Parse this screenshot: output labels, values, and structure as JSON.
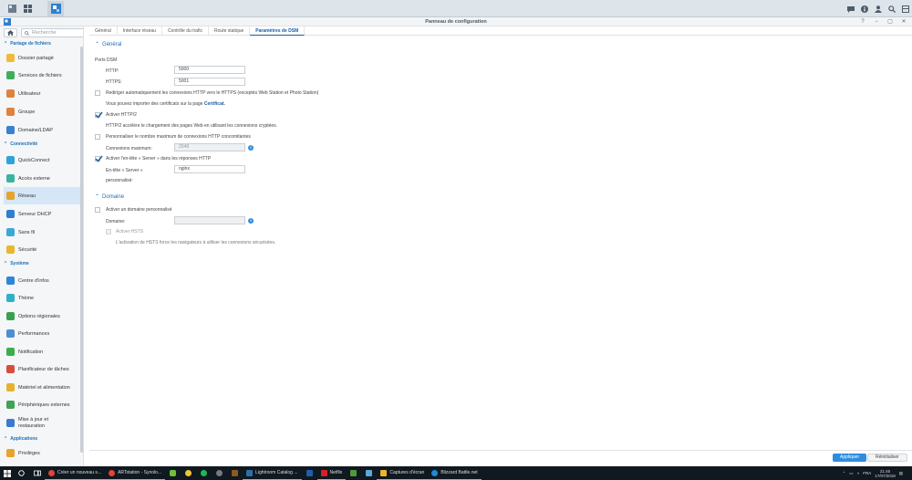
{
  "window": {
    "title": "Panneau de configuration"
  },
  "sidebar": {
    "search_placeholder": "Recherche",
    "sections": {
      "partage": "Partage de fichiers",
      "connectivite": "Connectivité",
      "systeme": "Système",
      "applications": "Applications"
    },
    "items": [
      {
        "label": "Dossier partagé",
        "color": "#f0b93a"
      },
      {
        "label": "Services de fichiers",
        "color": "#3fae5a"
      },
      {
        "label": "Utilisateur",
        "color": "#e0823c"
      },
      {
        "label": "Groupe",
        "color": "#e0823c"
      },
      {
        "label": "Domaine/LDAP",
        "color": "#3b7fd0"
      },
      {
        "label": "QuickConnect",
        "color": "#2fa3d8"
      },
      {
        "label": "Accès externe",
        "color": "#39b2a0"
      },
      {
        "label": "Réseau",
        "color": "#e6a32e"
      },
      {
        "label": "Serveur DHCP",
        "color": "#2f7ed0"
      },
      {
        "label": "Sans fil",
        "color": "#3aa9d9"
      },
      {
        "label": "Sécurité",
        "color": "#e9b82e"
      },
      {
        "label": "Centre d'infos",
        "color": "#2d86d6"
      },
      {
        "label": "Thème",
        "color": "#2fb0c8"
      },
      {
        "label": "Options régionales",
        "color": "#3aa04f"
      },
      {
        "label": "Performances",
        "color": "#4e8fcf"
      },
      {
        "label": "Notification",
        "color": "#3cae4e"
      },
      {
        "label": "Planificateur de tâches",
        "color": "#d84d3b"
      },
      {
        "label": "Matériel et alimentation",
        "color": "#e8b02c"
      },
      {
        "label": "Périphériques externes",
        "color": "#3fa353"
      },
      {
        "label": "Mise à jour et",
        "label2": "restauration",
        "color": "#3a7bd0"
      },
      {
        "label": "Privilèges",
        "color": "#e8a32c"
      }
    ]
  },
  "tabs": [
    "Général",
    "Interface réseau",
    "Contrôle du trafic",
    "Route statique",
    "Paramètres de DSM"
  ],
  "general": {
    "heading": "Général",
    "port_label": "Ports DSM",
    "http_label": "HTTP:",
    "http_value": "5000",
    "https_label": "HTTPS:",
    "https_value": "5001",
    "redirect_label": "Rediriger automatiquement les connexions HTTP vers le HTTPS (exceptés Web Station et Photo Station)",
    "cert_text": "Vous pouvez importer des certificats sur la page",
    "cert_link": "Certificat.",
    "http2_label": "Activer HTTP/2",
    "http2_desc": "HTTP/2 accélère le chargement des pages Web en utilisant les connexions cryptées.",
    "maxconn_label": "Personnaliser le nombre maximum de connexions HTTP concomitantes",
    "maxconn_field_label": "Connexions maximum:",
    "maxconn_value": "2048",
    "server_header_label": "Activer l'en-tête « Server » dans les réponses HTTP",
    "server_field_label": "En-tête « Server »",
    "server_field_label2": "personnalisé:",
    "server_value": "nginx"
  },
  "domain": {
    "heading": "Domaine",
    "custom_label": "Activer un domaine personnalisé",
    "domain_label": "Domaine:",
    "hsts_label": "Activer HSTS",
    "hsts_desc": "L'activation de HSTS force les navigateurs à utiliser les connexions sécurisées."
  },
  "buttons": {
    "apply": "Appliquer",
    "reset": "Réinitialiser"
  },
  "taskbar": {
    "apps": [
      {
        "label": "Créer un nouveau s...",
        "color": "#e0443a"
      },
      {
        "label": "ARTstation - Synolo...",
        "color": "#e0443a"
      },
      {
        "label": "Lightroom Catalog ...",
        "color": "#2d6ea8"
      },
      {
        "label": "Netflix",
        "color": "#d81f26"
      },
      {
        "label": "Captures d'écran",
        "color": "#e8b52c"
      },
      {
        "label": "Blizzard Battle.net",
        "color": "#1b8ad6"
      }
    ],
    "lang": "FRA",
    "time": "21:45",
    "date": "17/07/2018"
  }
}
